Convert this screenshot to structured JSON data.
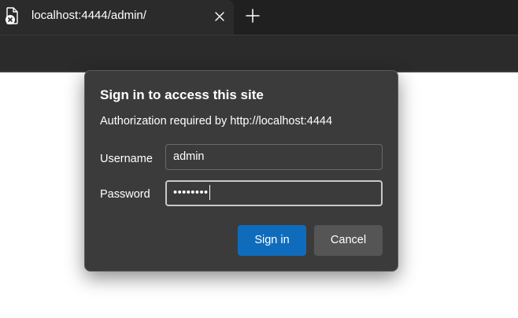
{
  "browser": {
    "tab": {
      "title": "localhost:4444/admin/",
      "favicon": "page-error-icon",
      "close_icon": "close-icon"
    },
    "new_tab_icon": "plus-icon"
  },
  "dialog": {
    "title": "Sign in to access this site",
    "subtitle": "Authorization required by http://localhost:4444",
    "username_label": "Username",
    "username_value": "admin",
    "password_label": "Password",
    "password_value": "••••••••",
    "signin_label": "Sign in",
    "cancel_label": "Cancel"
  },
  "colors": {
    "accent": "#0f6cbd",
    "dialog_bg": "#3b3b3b",
    "chrome_bg": "#202020",
    "toolbar_bg": "#2b2b2b"
  }
}
